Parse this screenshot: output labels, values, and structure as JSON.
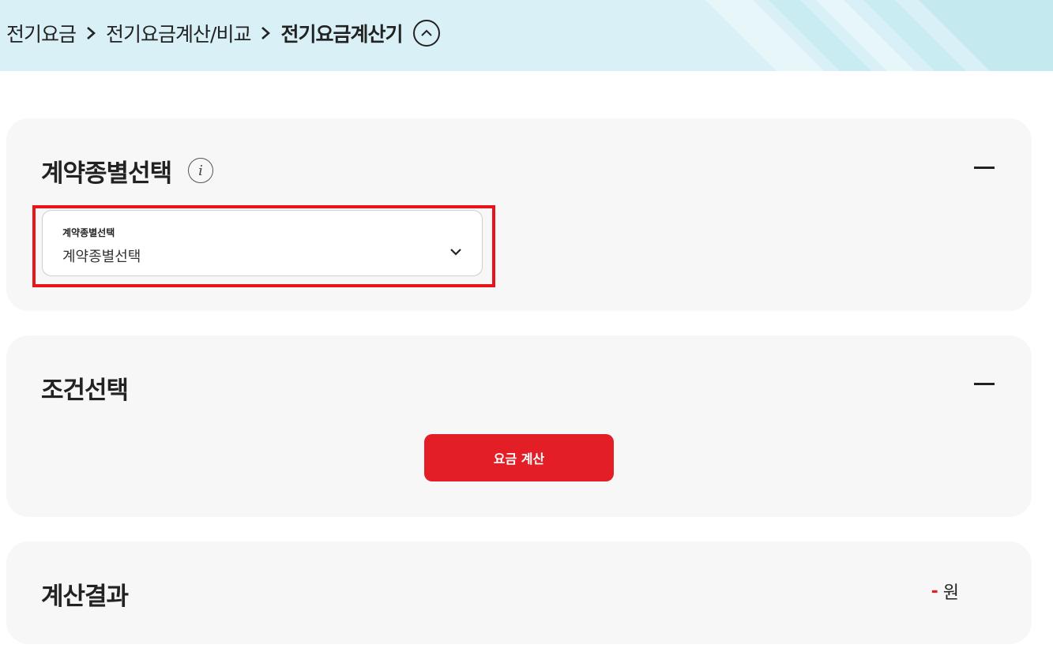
{
  "breadcrumb": {
    "items": [
      "전기요금",
      "전기요금계산/비교"
    ],
    "current": "전기요금계산기"
  },
  "contract_section": {
    "title": "계약종별선택",
    "info_icon": "info-icon",
    "select": {
      "label": "계약종별선택",
      "value": "계약종별선택"
    }
  },
  "condition_section": {
    "title": "조건선택",
    "calc_button": "요금 계산"
  },
  "result_section": {
    "title": "계산결과",
    "value": "-",
    "unit": "원"
  },
  "colors": {
    "accent": "#e41e26",
    "header_bg": "#d9f1f6",
    "card_bg": "#f7f7f7"
  }
}
